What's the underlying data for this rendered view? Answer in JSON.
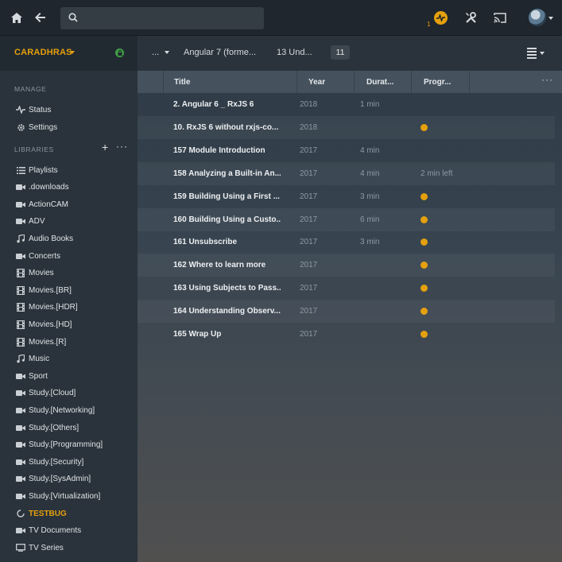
{
  "topbar": {
    "search_placeholder": "",
    "activity_count": "1",
    "icons": [
      "home-icon",
      "back-icon",
      "search-icon",
      "activity-icon",
      "settings-icon",
      "cast-icon",
      "avatar"
    ]
  },
  "sidebar": {
    "server_name": "CARADHRAS",
    "manage_title": "MANAGE",
    "libraries_title": "LIBRARIES",
    "manage_items": [
      {
        "label": "Status",
        "icon": "pulse-icon"
      },
      {
        "label": "Settings",
        "icon": "gear-icon"
      }
    ],
    "library_items": [
      {
        "label": "Playlists",
        "icon": "list-icon"
      },
      {
        "label": ".downloads",
        "icon": "video-camera-icon"
      },
      {
        "label": "ActionCAM",
        "icon": "video-camera-icon"
      },
      {
        "label": "ADV",
        "icon": "video-camera-icon"
      },
      {
        "label": "Audio Books",
        "icon": "music-note-icon"
      },
      {
        "label": "Concerts",
        "icon": "video-camera-icon"
      },
      {
        "label": "Movies",
        "icon": "film-icon"
      },
      {
        "label": "Movies.[BR]",
        "icon": "film-icon"
      },
      {
        "label": "Movies.[HDR]",
        "icon": "film-icon"
      },
      {
        "label": "Movies.[HD]",
        "icon": "film-icon"
      },
      {
        "label": "Movies.[R]",
        "icon": "film-icon"
      },
      {
        "label": "Music",
        "icon": "music-note-icon"
      },
      {
        "label": "Sport",
        "icon": "video-camera-icon"
      },
      {
        "label": "Study.[Cloud]",
        "icon": "video-camera-icon"
      },
      {
        "label": "Study.[Networking]",
        "icon": "video-camera-icon"
      },
      {
        "label": "Study.[Others]",
        "icon": "video-camera-icon"
      },
      {
        "label": "Study.[Programming]",
        "icon": "video-camera-icon"
      },
      {
        "label": "Study.[Security]",
        "icon": "video-camera-icon"
      },
      {
        "label": "Study.[SysAdmin]",
        "icon": "video-camera-icon"
      },
      {
        "label": "Study.[Virtualization]",
        "icon": "video-camera-icon"
      },
      {
        "label": "TESTBUG",
        "icon": "loading-icon",
        "active": true
      },
      {
        "label": "TV Documents",
        "icon": "video-camera-icon"
      },
      {
        "label": "TV Series",
        "icon": "tv-icon"
      }
    ]
  },
  "header": {
    "crumb_more": "...",
    "show_title": "Angular 7 (forme...",
    "season_title": "13 Und...",
    "count": "11"
  },
  "table": {
    "columns": [
      "Title",
      "Year",
      "Durat...",
      "Progr..."
    ],
    "rows": [
      {
        "title": "2. Angular 6 _ RxJS 6",
        "year": "2018",
        "duration": "1 min",
        "progress": "",
        "in_progress": false
      },
      {
        "title": "10. RxJS 6 without rxjs-co...",
        "year": "2018",
        "duration": "",
        "progress": "",
        "in_progress": true
      },
      {
        "title": "157 Module Introduction",
        "year": "2017",
        "duration": "4 min",
        "progress": "",
        "in_progress": false
      },
      {
        "title": "158 Analyzing a Built-in An...",
        "year": "2017",
        "duration": "4 min",
        "progress": "2 min left",
        "in_progress": false
      },
      {
        "title": "159 Building Using a First ...",
        "year": "2017",
        "duration": "3 min",
        "progress": "",
        "in_progress": true
      },
      {
        "title": "160 Building Using a Custo...",
        "year": "2017",
        "duration": "6 min",
        "progress": "",
        "in_progress": true
      },
      {
        "title": "161 Unsubscribe",
        "year": "2017",
        "duration": "3 min",
        "progress": "",
        "in_progress": true
      },
      {
        "title": "162 Where to learn more",
        "year": "2017",
        "duration": "",
        "progress": "",
        "in_progress": true
      },
      {
        "title": "163 Using Subjects to Pass...",
        "year": "2017",
        "duration": "",
        "progress": "",
        "in_progress": true
      },
      {
        "title": "164 Understanding Observ...",
        "year": "2017",
        "duration": "",
        "progress": "",
        "in_progress": true
      },
      {
        "title": "165 Wrap Up",
        "year": "2017",
        "duration": "",
        "progress": "",
        "in_progress": true
      }
    ]
  },
  "colors": {
    "accent": "#e5a00d",
    "sidebar_bg": "#2a333b",
    "topbar_bg": "#1f262d"
  }
}
